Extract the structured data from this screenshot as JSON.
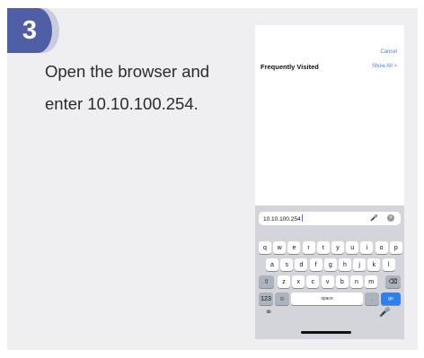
{
  "step": {
    "number": "3"
  },
  "instruction": {
    "line1": "Open the browser and",
    "line2": "enter 10.10.100.254."
  },
  "phone": {
    "cancel": "Cancel",
    "frequently_visited": "Frequently Visited",
    "show_all": "Show All >",
    "url_value": "10.10.100.254",
    "url_mic_icon": "mic-icon",
    "url_clear_icon": "clear-icon",
    "keyboard": {
      "row1": [
        "q",
        "w",
        "e",
        "r",
        "t",
        "y",
        "u",
        "i",
        "o",
        "p"
      ],
      "row2": [
        "a",
        "s",
        "d",
        "f",
        "g",
        "h",
        "j",
        "k",
        "l"
      ],
      "row3": [
        "z",
        "x",
        "c",
        "v",
        "b",
        "n",
        "m"
      ],
      "shift_icon": "shift-icon",
      "backspace_icon": "backspace-icon",
      "key_123": "123",
      "emoji_icon": "emoji-icon",
      "space": "space",
      "period": ".",
      "go": "go",
      "globe_icon": "globe-icon",
      "dictation_icon": "mic-icon"
    }
  },
  "colors": {
    "badge": "#4f5fa6",
    "card_bg": "#efeef0",
    "go_key": "#2f80ec",
    "link": "#4a7fd6"
  }
}
